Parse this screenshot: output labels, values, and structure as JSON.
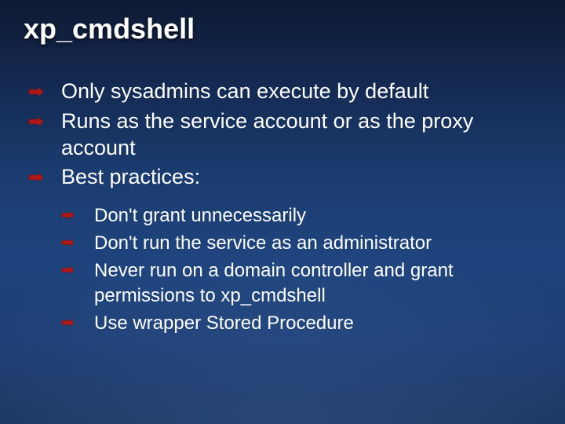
{
  "title": "xp_cmdshell",
  "bullets": [
    "Only sysadmins can execute by default",
    "Runs as the service account or as the proxy account",
    "Best practices:"
  ],
  "sub_bullets": [
    "Don't grant unnecessarily",
    "Don't run the service as an administrator",
    "Never run on a domain controller and grant permissions to xp_cmdshell",
    "Use wrapper Stored Procedure"
  ]
}
